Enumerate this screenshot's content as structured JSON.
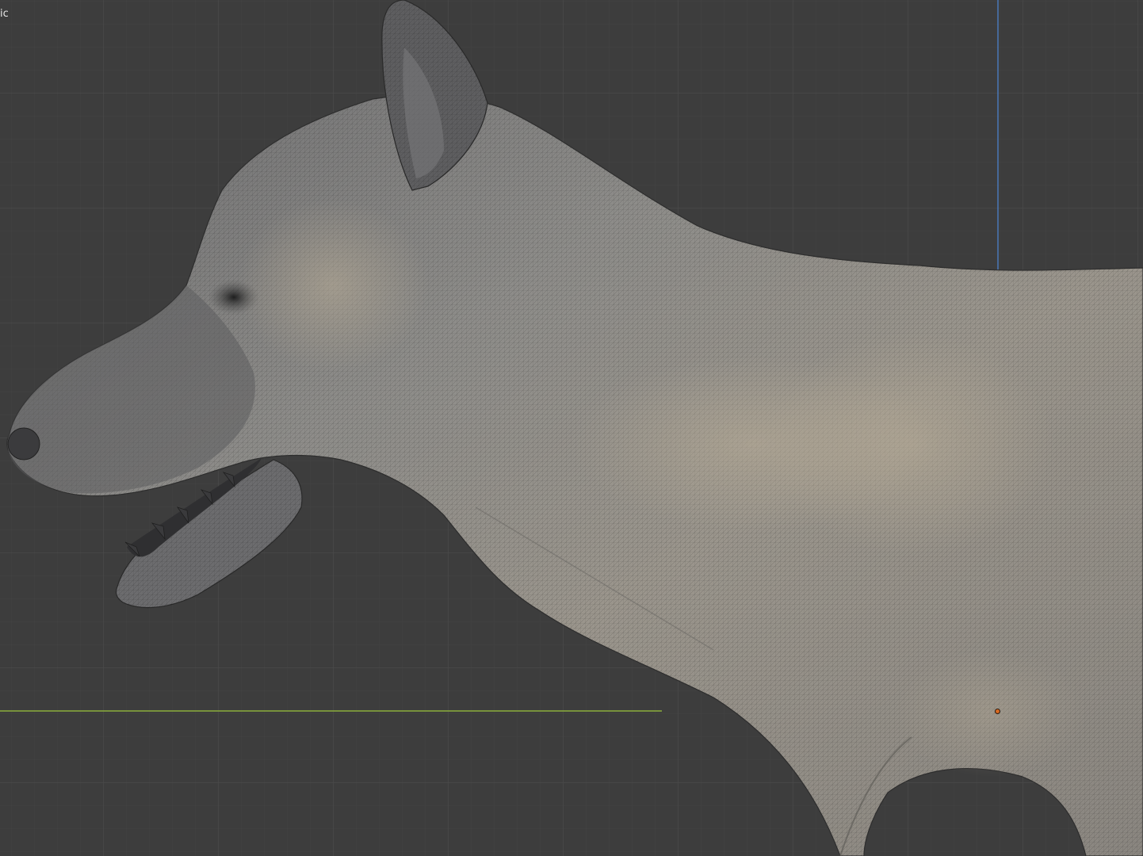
{
  "viewport": {
    "view_label": "ic",
    "background_color": "#3d3d3d",
    "grid_minor_color": "#444444",
    "grid_major_color": "#4c4c4c",
    "x_axis_color": "#8cae3c",
    "z_axis_color": "#4a78b8",
    "origin_color": "#d86a22"
  },
  "model": {
    "subject": "wolf",
    "mesh_color": "#8e8c87",
    "wireframe": true
  }
}
